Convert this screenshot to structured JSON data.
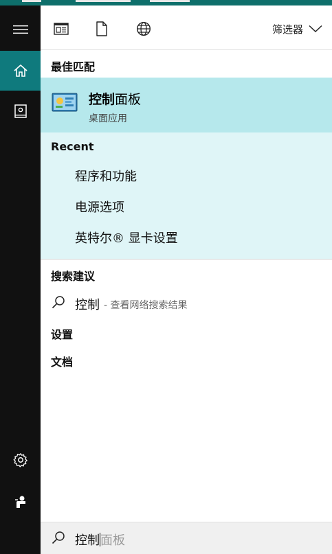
{
  "rail": {
    "items": [
      {
        "icon": "hamburger-menu-icon",
        "active": false
      },
      {
        "icon": "home-icon",
        "active": true
      },
      {
        "icon": "notebook-icon",
        "active": false
      },
      {
        "icon": "gear-icon",
        "active": false
      },
      {
        "icon": "feedback-icon",
        "active": false
      }
    ]
  },
  "toolbar": {
    "filter_label": "筛选器",
    "icons": [
      "apps-filter-icon",
      "documents-filter-icon",
      "web-filter-icon"
    ]
  },
  "best_match": {
    "title": "最佳匹配",
    "app_name_bold": "控制",
    "app_name_rest": "面板",
    "app_type": "桌面应用",
    "icon": "control-panel-icon"
  },
  "recent": {
    "title": "Recent",
    "items": [
      "程序和功能",
      "电源选项",
      "英特尔® 显卡设置"
    ]
  },
  "suggestions": {
    "title": "搜索建议",
    "term": "控制",
    "hint": "- 查看网络搜索结果"
  },
  "sections": {
    "settings": "设置",
    "documents": "文档"
  },
  "searchbox": {
    "typed": "控制",
    "completion": "面板"
  },
  "colors": {
    "rail_bg": "#111111",
    "rail_active": "#0f7a7d",
    "best_match_bg": "#b6e8ec",
    "recent_bg": "#dff5f7",
    "top_strip": "#0e6f6b"
  }
}
